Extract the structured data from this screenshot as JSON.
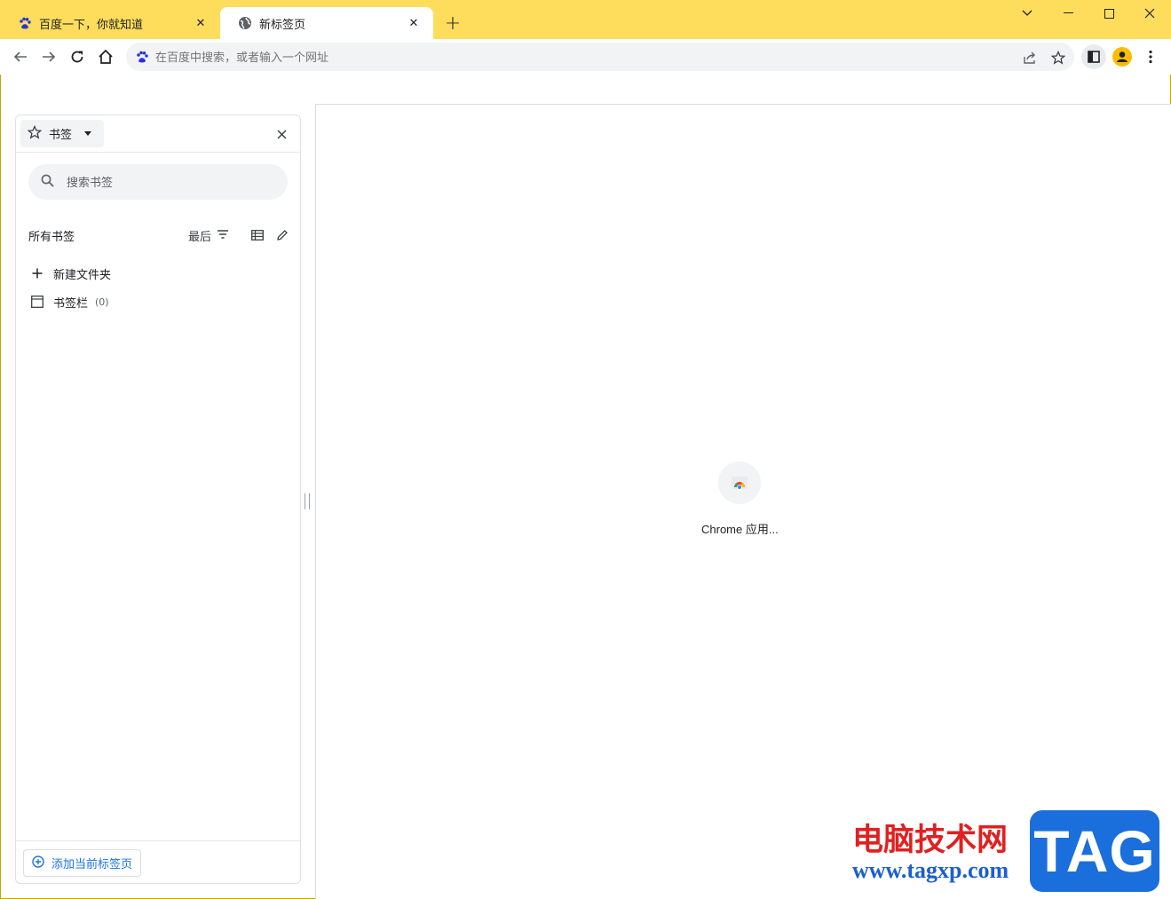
{
  "tabs": [
    {
      "title": "百度一下，你就知道",
      "icon": "baidu-paw-icon",
      "active": false,
      "close_label": "✕"
    },
    {
      "title": "新标签页",
      "icon": "globe-icon",
      "active": true,
      "close_label": "✕"
    }
  ],
  "new_tab_label": "+",
  "omnibox": {
    "placeholder": "在百度中搜索，或者输入一个网址",
    "search_engine_icon": "baidu-paw-icon"
  },
  "side_panel": {
    "selector_label": "书签",
    "search_placeholder": "搜索书签",
    "all_bookmarks_label": "所有书签",
    "sort_label": "最后",
    "items": [
      {
        "label": "新建文件夹",
        "icon": "plus-icon"
      },
      {
        "label": "书签栏",
        "icon": "folder-icon",
        "count": "(0)"
      }
    ],
    "add_current_tab_label": "添加当前标签页"
  },
  "content": {
    "shortcut_label": "Chrome 应用..."
  },
  "watermark": {
    "site_name": "电脑技术网",
    "url": "www.tagxp.com",
    "tag": "TAG"
  },
  "colors": {
    "tabstrip": "#fedd5d",
    "accent": "#1a73e8",
    "omnibox_bg": "#f1f3f4",
    "watermark_red": "#e02020",
    "watermark_blue": "#1b6fdc"
  }
}
